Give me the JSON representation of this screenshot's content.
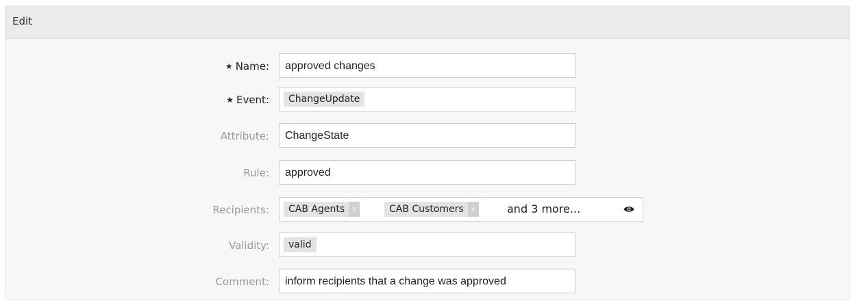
{
  "panel": {
    "title": "Edit"
  },
  "form": {
    "name": {
      "label": "Name:",
      "required": true,
      "value": "approved changes"
    },
    "event": {
      "label": "Event:",
      "required": true,
      "tag": "ChangeUpdate"
    },
    "attribute": {
      "label": "Attribute:",
      "value": "ChangeState"
    },
    "rule": {
      "label": "Rule:",
      "value": "approved"
    },
    "recipients": {
      "label": "Recipients:",
      "tags": [
        {
          "label": "CAB Agents",
          "remove": "x"
        },
        {
          "label": "CAB Customers",
          "remove": "x"
        }
      ],
      "more": "and 3 more...",
      "icon": "eye-icon"
    },
    "validity": {
      "label": "Validity:",
      "tag": "valid"
    },
    "comment": {
      "label": "Comment:",
      "value": "inform recipients that a change was approved"
    }
  }
}
